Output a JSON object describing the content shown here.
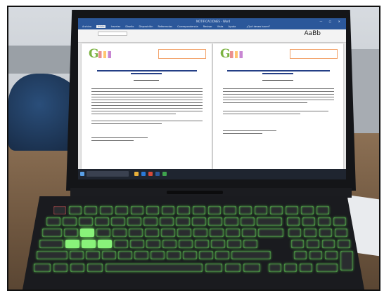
{
  "word": {
    "doc_title": "NOTIFICACIONES - Word",
    "menu": [
      "Archivo",
      "Inicio",
      "Insertar",
      "Diseño",
      "Disposición",
      "Referencias",
      "Correspondencia",
      "Revisar",
      "Vista",
      "Ayuda",
      "¿Qué desea hacer?"
    ],
    "ribbon_style_sample": "AaBb"
  },
  "pages": [
    {
      "logo": "G",
      "heading_label": "RESOLUCIÓN"
    },
    {
      "logo": "G",
      "heading_label": "NOTIFICACIÓN"
    }
  ],
  "colors": {
    "word_blue": "#2b579a",
    "keyboard_backlight": "#6dff5a",
    "logo_green": "#7cb342"
  }
}
